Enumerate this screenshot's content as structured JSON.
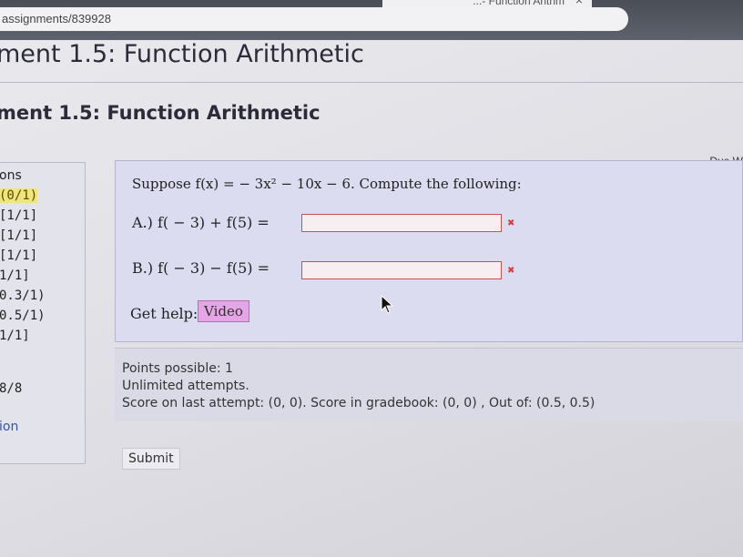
{
  "browser": {
    "tab_title": "...- Function Arithm",
    "tab_close": "×",
    "url": "assignments/839928"
  },
  "header": {
    "title": "ment 1.5: Function Arithmetic",
    "subtitle": "ment 1.5: Function Arithmetic",
    "due": "Due W"
  },
  "sidebar": {
    "heading": "ons",
    "items": [
      "(0/1)",
      "[1/1]",
      "[1/1]",
      "[1/1]",
      "1/1]",
      "0.3/1)",
      "0.5/1)",
      "1/1]"
    ],
    "total": "8/8",
    "link": "ion"
  },
  "question": {
    "prompt": "Suppose f(x) = − 3x² − 10x − 6. Compute the following:",
    "part_a_label": "A.) f( − 3) + f(5) =",
    "part_a_value": "",
    "part_b_label": "B.) f( − 3) − f(5) =",
    "part_b_value": "",
    "help_label": "Get help:",
    "video_label": "Video",
    "error_mark": "✖"
  },
  "info": {
    "points": "Points possible: 1",
    "attempts": "Unlimited attempts.",
    "score": "Score on last attempt: (0, 0). Score in gradebook: (0, 0) , Out of: (0.5, 0.5)"
  },
  "submit_label": "Submit",
  "colors": {
    "current_item_highlight": "#efe57a",
    "input_border_error": "#c85050",
    "video_button": "#e6a6e6",
    "question_background": "#dcdcf0"
  }
}
